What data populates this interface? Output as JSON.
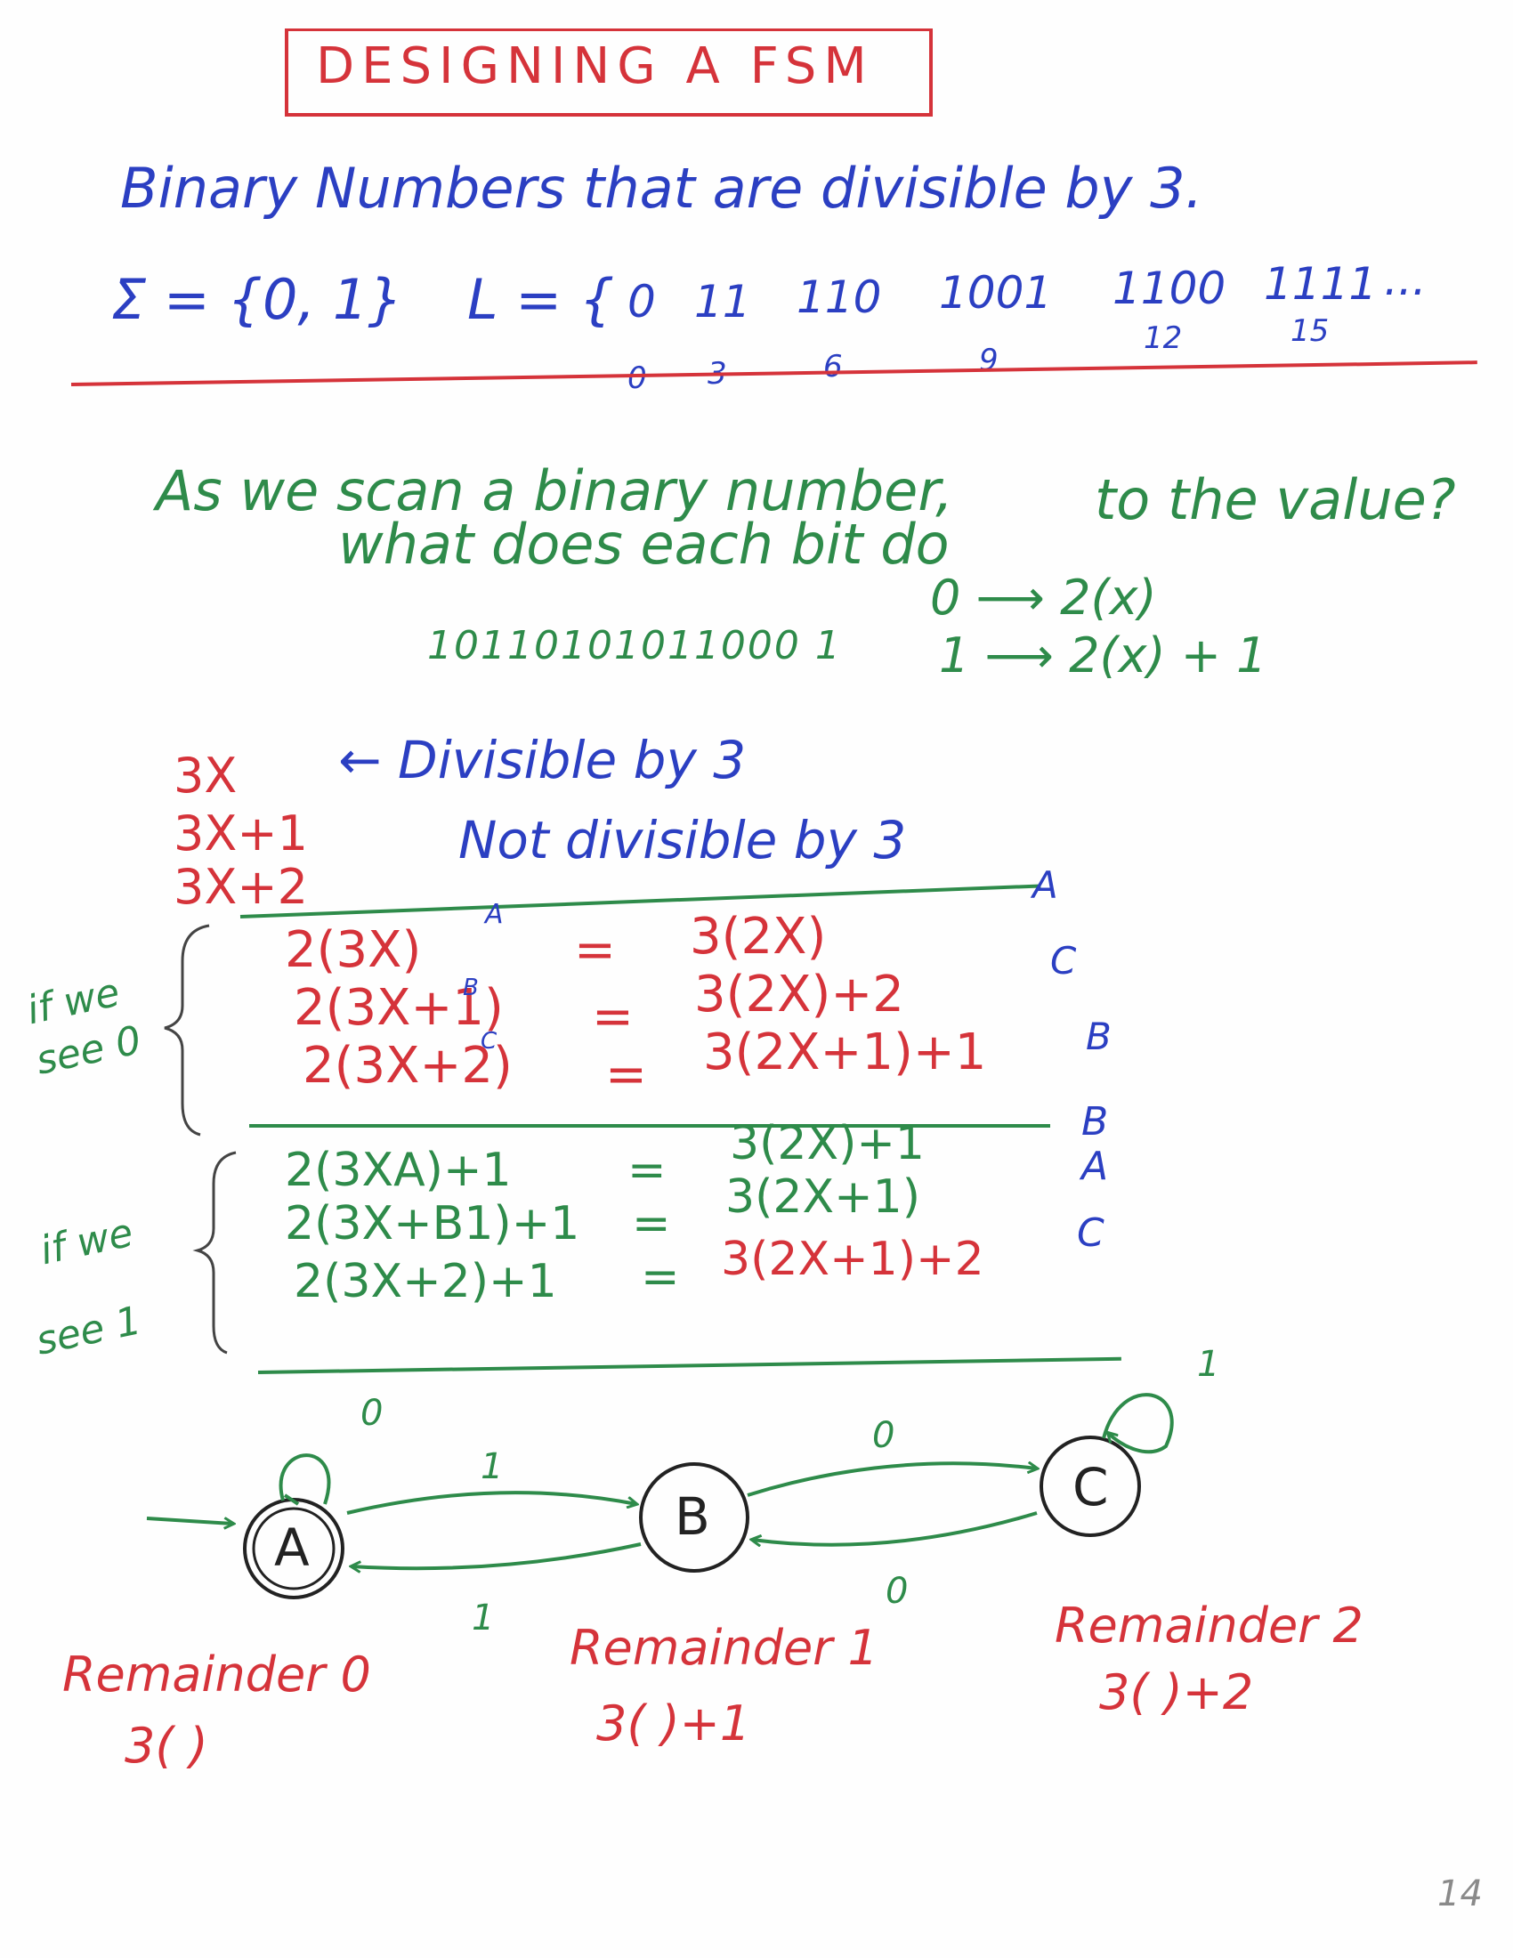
{
  "title": "DESIGNING  A  FSM",
  "problem": "Binary Numbers that are divisible by 3.",
  "alphabet": "Σ = {0, 1}",
  "language_label": "L = {",
  "language_strings": [
    "0",
    "11",
    "110",
    "1001",
    "1100",
    "1111",
    "..."
  ],
  "language_values": [
    "0",
    "3",
    "6",
    "9",
    "12",
    "15"
  ],
  "question_line1": "As we scan a binary number,",
  "question_line2": "to the value?",
  "question_line3": "what does each bit do",
  "example_binary": "10110101011000 1",
  "bit_rule_0": "0 ⟶ 2(x)",
  "bit_rule_1": "1 ⟶ 2(x) + 1",
  "cases": {
    "c0": "3X",
    "c1": "3X+1",
    "c2": "3X+2",
    "divisible": "← Divisible by 3",
    "not_divisible": "Not divisible by 3"
  },
  "see0_label": [
    "if we",
    "see 0"
  ],
  "see1_label": [
    "if we",
    "see 1"
  ],
  "see0_rows": [
    {
      "lhs": "2(3X)",
      "eq": "=",
      "rhs": "3(2X)",
      "state": "A",
      "tag": "A"
    },
    {
      "lhs": "2(3X+1)",
      "eq": "=",
      "rhs": "3(2X)+2",
      "state": "C",
      "tag": "B"
    },
    {
      "lhs": "2(3X+2)",
      "eq": "=",
      "rhs": "3(2X+1)+1",
      "state": "B",
      "tag": "C"
    }
  ],
  "see1_rows": [
    {
      "lhs": "2(3XA)+1",
      "eq": "=",
      "rhs": "3(2X)+1",
      "state": "B"
    },
    {
      "lhs": "2(3X+B1)+1",
      "eq": "=",
      "rhs": "3(2X+1)",
      "state": "A"
    },
    {
      "lhs": "2(3X+2)+1",
      "eq": "=",
      "rhs": "3(2X+1)+2",
      "state": "C"
    }
  ],
  "fsm": {
    "states": [
      "A",
      "B",
      "C"
    ],
    "labels": {
      "a_self": "0",
      "ab": "1",
      "ba": "1",
      "bc": "0",
      "cb": "0",
      "c_self": "1"
    }
  },
  "remainders": [
    {
      "name": "Remainder 0",
      "form": "3(   )"
    },
    {
      "name": "Remainder 1",
      "form": "3(   )+1"
    },
    {
      "name": "Remainder 2",
      "form": "3(   )+2"
    }
  ],
  "page_number": "14",
  "colors": {
    "red": "#d5333a",
    "blue": "#2b3fc2",
    "green": "#2e8b4a"
  }
}
